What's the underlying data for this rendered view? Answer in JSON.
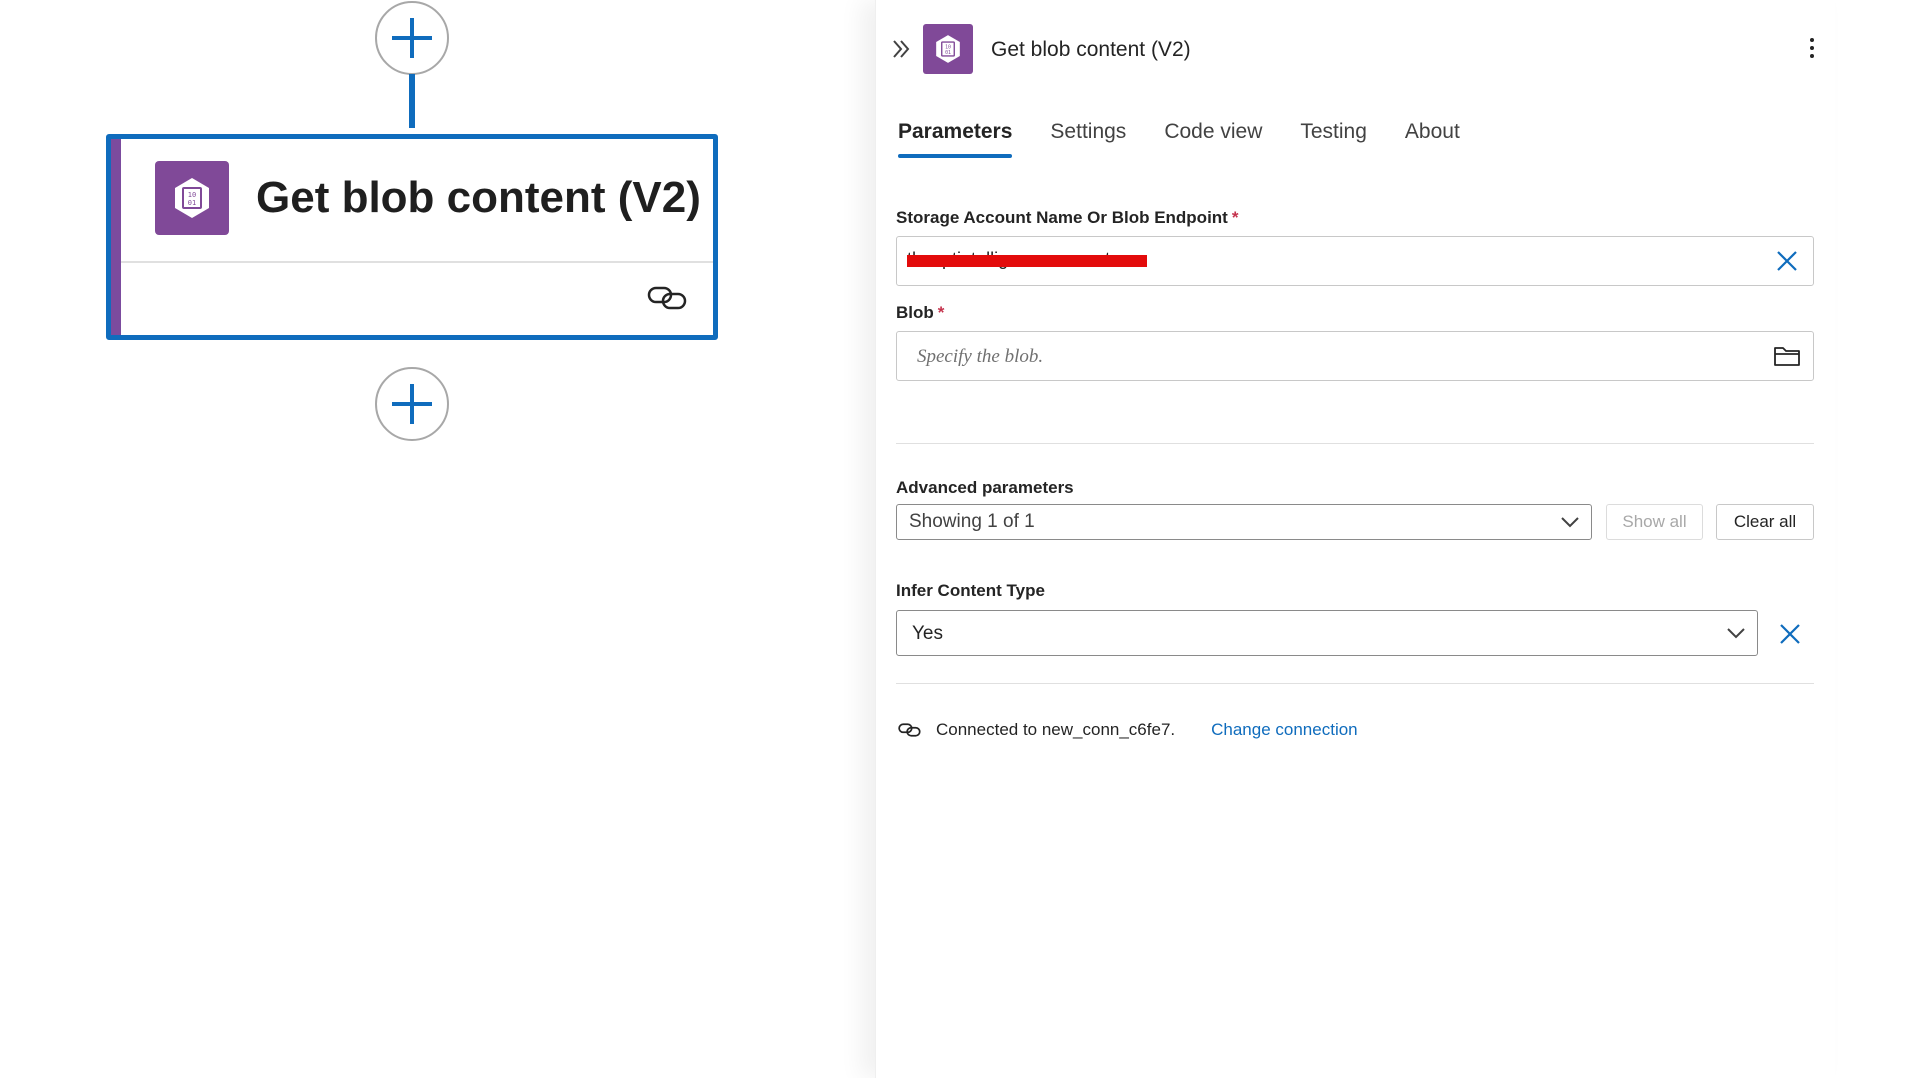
{
  "canvas": {
    "node": {
      "title": "Get blob content (V2)",
      "icon": "blob-storage-icon",
      "connection_icon": "link-icon"
    },
    "add_step_icon": "plus-icon"
  },
  "panel": {
    "title": "Get blob content (V2)",
    "collapse_icon": "double-chevron-right-icon",
    "more_icon": "more-vertical-icon",
    "tabs": [
      {
        "label": "Parameters",
        "active": true
      },
      {
        "label": "Settings",
        "active": false
      },
      {
        "label": "Code view",
        "active": false
      },
      {
        "label": "Testing",
        "active": false
      },
      {
        "label": "About",
        "active": false
      }
    ],
    "fields": {
      "storage_account": {
        "label": "Storage Account Name Or Blob Endpoint",
        "required_mark": "*",
        "value_redacted": "theaptintelligenceaccount"
      },
      "blob": {
        "label": "Blob",
        "required_mark": "*",
        "placeholder": "Specify the blob."
      }
    },
    "advanced": {
      "label": "Advanced parameters",
      "dropdown_value": "Showing 1 of 1",
      "show_all_label": "Show all",
      "clear_all_label": "Clear all"
    },
    "infer_content_type": {
      "label": "Infer Content Type",
      "value": "Yes"
    },
    "connection": {
      "text": "Connected to new_conn_c6fe7.",
      "change_label": "Change connection"
    }
  },
  "colors": {
    "accent": "#0f6cbd",
    "connector_purple": "#804998",
    "required": "#c4314b",
    "redaction": "#e30b0b"
  }
}
